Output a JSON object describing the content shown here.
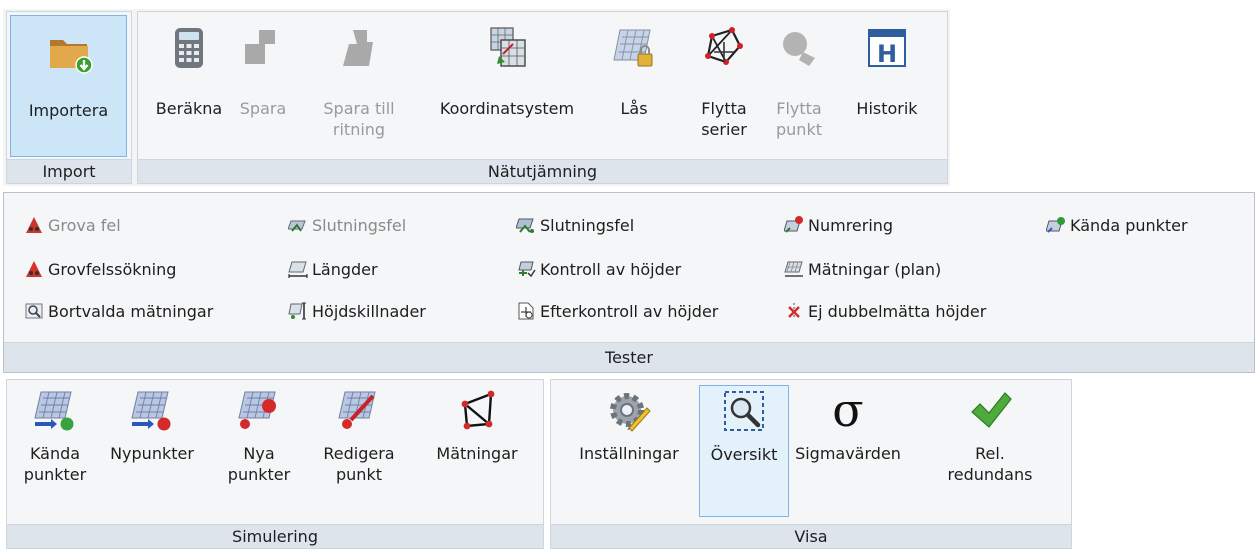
{
  "ribbon1": {
    "import_group": {
      "label": "Import",
      "buttons": [
        {
          "label": "Importera",
          "icon": "folder-import-icon"
        }
      ]
    },
    "adjust_group": {
      "label": "Nätutjämning",
      "buttons": [
        {
          "label": "Beräkna",
          "icon": "calculator-icon"
        },
        {
          "label": "Spara",
          "icon": "save-icon"
        },
        {
          "label": "Spara till\nritning",
          "icon": "save-to-drawing-icon"
        },
        {
          "label": "Koordinatsystem",
          "icon": "coordinate-system-icon"
        },
        {
          "label": "Lås",
          "icon": "lock-grid-icon"
        },
        {
          "label": "Flytta\nserier",
          "icon": "move-series-icon"
        },
        {
          "label": "Flytta\npunkt",
          "icon": "move-point-icon"
        },
        {
          "label": "Historik",
          "icon": "history-icon"
        }
      ]
    }
  },
  "tester": {
    "label": "Tester",
    "col1": [
      "Grova fel",
      "Grovfelssökning",
      "Bortvalda mätningar"
    ],
    "col2": [
      "Slutningsfel",
      "Längder",
      "Höjdskillnader"
    ],
    "col3": [
      "Slutningsfel",
      "Kontroll av höjder",
      "Efterkontroll av höjder"
    ],
    "col4": [
      "Numrering",
      "Mätningar (plan)",
      "Ej dubbelmätta höjder"
    ],
    "col5": [
      "Kända punkter"
    ]
  },
  "simulering": {
    "label": "Simulering",
    "buttons": [
      {
        "label": "Kända\npunkter",
        "icon": "known-points-icon"
      },
      {
        "label": "Nypunkter",
        "icon": "new-points-icon"
      },
      {
        "label": "Nya\npunkter",
        "icon": "new-points-red-icon"
      },
      {
        "label": "Redigera\npunkt",
        "icon": "edit-point-icon"
      },
      {
        "label": "Mätningar",
        "icon": "measurements-icon"
      }
    ]
  },
  "visa": {
    "label": "Visa",
    "buttons": [
      {
        "label": "Inställningar",
        "icon": "settings-icon"
      },
      {
        "label": "Översikt",
        "icon": "overview-icon"
      },
      {
        "label": "Sigmavärden",
        "icon": "sigma-icon"
      },
      {
        "label": "Rel.\nredundans",
        "icon": "checkmark-icon"
      }
    ]
  }
}
